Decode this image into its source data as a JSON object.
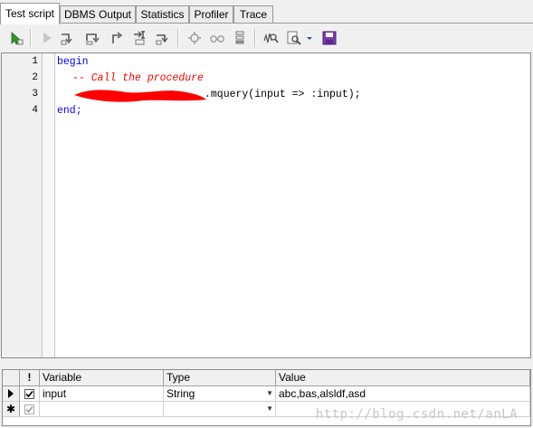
{
  "tabs": [
    {
      "label": "Test script",
      "active": true
    },
    {
      "label": "DBMS Output",
      "active": false
    },
    {
      "label": "Statistics",
      "active": false
    },
    {
      "label": "Profiler",
      "active": false
    },
    {
      "label": "Trace",
      "active": false
    }
  ],
  "toolbar": {
    "icons": [
      "debug-start-icon",
      "run-icon",
      "step-into-icon",
      "step-over-icon",
      "step-out-icon",
      "run-to-next-exception-icon",
      "run-to-exception-icon",
      "toggle-breakpoint-icon",
      "watch-icon",
      "call-stack-icon",
      "search-icon",
      "find-icon",
      "dropdown-arrow-icon",
      "save-icon"
    ]
  },
  "editor": {
    "line_numbers": [
      "1",
      "2",
      "3",
      "4"
    ],
    "lines": {
      "l1": "begin",
      "l2": "-- Call the procedure",
      "l3": ".mquery(input => :input);",
      "l4": "end;"
    },
    "redaction_color": "#ff0000"
  },
  "grid": {
    "headers": {
      "flag": "!",
      "variable": "Variable",
      "type": "Type",
      "value": "Value"
    },
    "rows": [
      {
        "variable": "input",
        "type": "String",
        "value": "abc,bas,alsldf,asd",
        "checked": true
      }
    ]
  },
  "watermark": "http://blog.csdn.net/anLA"
}
